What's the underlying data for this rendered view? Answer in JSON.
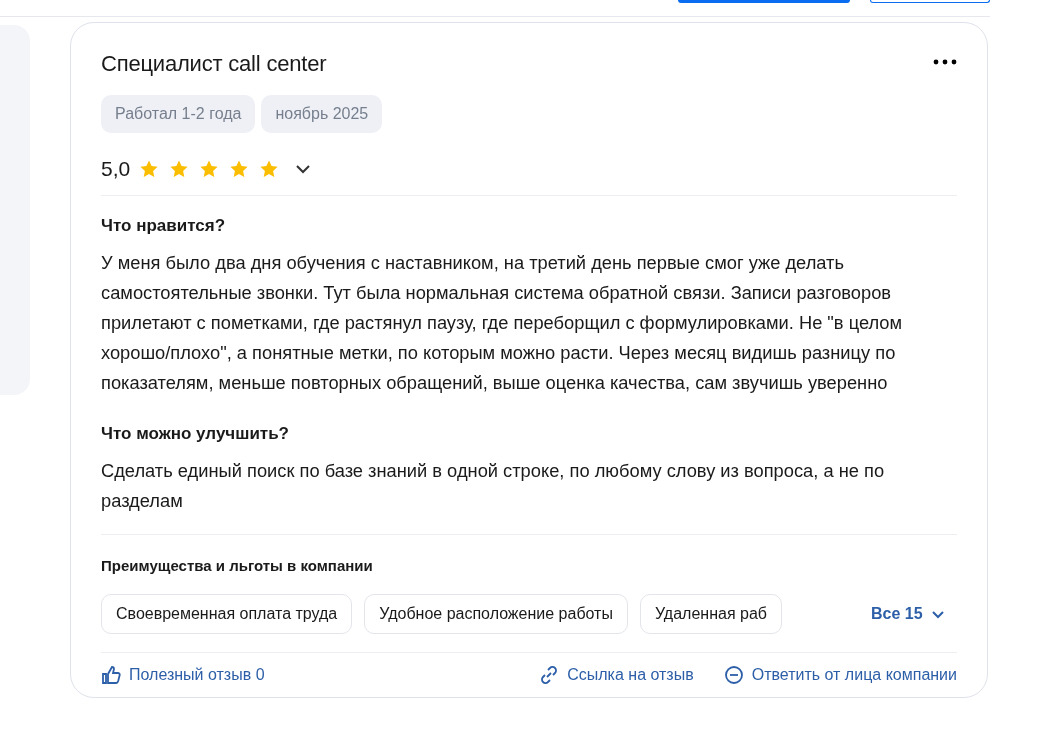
{
  "review": {
    "title": "Специалист call center",
    "tags": [
      "Работал 1-2 года",
      "ноябрь 2025"
    ],
    "rating": "5,0",
    "stars": 5,
    "sections": [
      {
        "heading": "Что нравится?",
        "text": "У меня было два дня обучения с наставником, на третий день первые смог уже делать самостоятельные звонки. Тут была нормальная система обратной связи. Записи разговоров прилетают с пометками, где растянул паузу, где переборщил с формулировками. Не \"в целом хорошо/плохо\", а понятные метки, по которым можно расти. Через месяц видишь разницу по показателям, меньше повторных обращений, выше оценка качества, сам звучишь уверенно"
      },
      {
        "heading": "Что можно улучшить?",
        "text": "Сделать единый поиск по базе знаний в одной строке, по любому слову из вопроса, а не по разделам"
      }
    ],
    "benefits": {
      "heading": "Преимущества и льготы в компании",
      "items": [
        "Своевременная оплата труда",
        "Удобное расположение работы",
        "Удаленная раб"
      ],
      "more": "Все 15"
    },
    "actions": [
      {
        "kind": "like",
        "label": "Полезный отзыв 0"
      },
      {
        "kind": "link",
        "label": "Ссылка на отзыв"
      },
      {
        "kind": "reply",
        "label": "Ответить от лица компании"
      }
    ]
  }
}
